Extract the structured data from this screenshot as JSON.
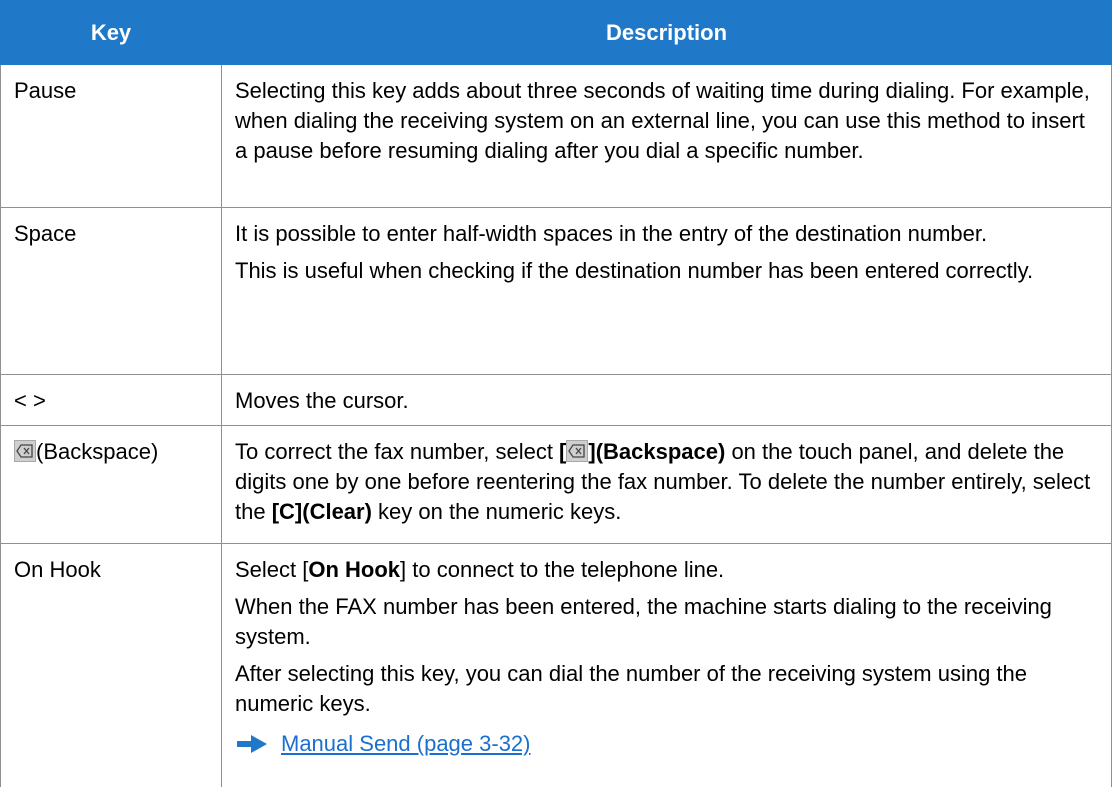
{
  "header": {
    "key": "Key",
    "description": "Description"
  },
  "rows": {
    "pause": {
      "key": "Pause",
      "desc": "Selecting this key adds about three seconds of waiting time during dialing. For example, when dialing the receiving system on an external line, you can use this method to insert a pause before resuming dialing after you dial a specific number."
    },
    "space": {
      "key": "Space",
      "p1": "It is possible to enter half-width spaces in the entry of the destination number.",
      "p2": "This is useful when checking if the destination number has been entered correctly."
    },
    "cursor": {
      "key": "< >",
      "desc": "Moves the cursor."
    },
    "backspace": {
      "key": "(Backspace)",
      "t1": "To correct the fax number, select ",
      "t1_open": "[",
      "t1_bold": "](Backspace)",
      "t2": " on the touch panel, and delete the digits one by one before reentering the fax number. To delete the number entirely, select the ",
      "t2_bold": "[C](Clear)",
      "t3": " key on the numeric keys."
    },
    "onhook": {
      "key": "On Hook",
      "p1_a": "Select [",
      "p1_bold": "On Hook",
      "p1_b": "] to connect to the telephone line.",
      "p2": "When the FAX number has been entered, the machine starts dialing to the receiving system.",
      "p3": "After selecting this key, you can dial the number of the receiving system using the numeric keys.",
      "link": "Manual Send (page 3-32)"
    }
  },
  "colors": {
    "header_bg": "#1f78c8",
    "link": "#1a6fcf",
    "border": "#8f8f8f"
  },
  "icons": {
    "backspace": "backspace-icon",
    "arrow": "right-arrow-icon"
  }
}
